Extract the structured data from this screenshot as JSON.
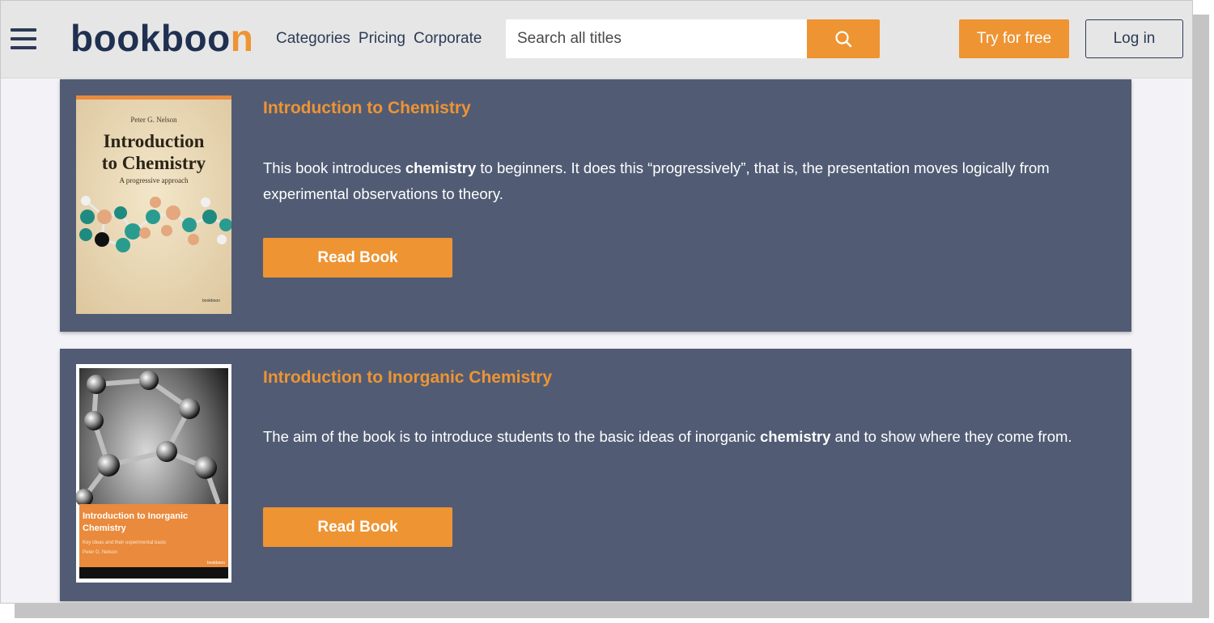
{
  "header": {
    "logo": {
      "main": "bookboo",
      "accent": "n"
    },
    "nav": [
      "Categories",
      "Pricing",
      "Corporate"
    ],
    "search": {
      "placeholder": "Search all titles",
      "value": ""
    },
    "try_label": "Try for free",
    "login_label": "Log in",
    "colors": {
      "accent": "#ee9433",
      "brand_dark": "#1f3050"
    }
  },
  "books": [
    {
      "title": "Introduction to Chemistry",
      "desc_before": "This book introduces ",
      "desc_highlight": "chemistry",
      "desc_after": " to beginners. It does this “progressively”, that is, the presentation moves logically from experimental observations to theory.",
      "button": "Read Book",
      "cover": {
        "author": "Peter G. Nelson",
        "title_line1": "Introduction",
        "title_line2": "to Chemistry",
        "subtitle": "A progressive approach",
        "publisher": "bookboon"
      }
    },
    {
      "title": "Introduction to Inorganic Chemistry",
      "desc_before": "The aim of the book is to introduce students to the basic ideas of inorganic ",
      "desc_highlight": "chemistry",
      "desc_after": " and to show where they come from.",
      "button": "Read Book",
      "cover": {
        "title_line1": "Introduction to Inorganic",
        "title_line2": "Chemistry",
        "subtitle": "Key ideas and their experimental basis",
        "author": "Peter G. Nelson",
        "publisher": "bookboon"
      }
    }
  ],
  "card_color": "#515c74"
}
